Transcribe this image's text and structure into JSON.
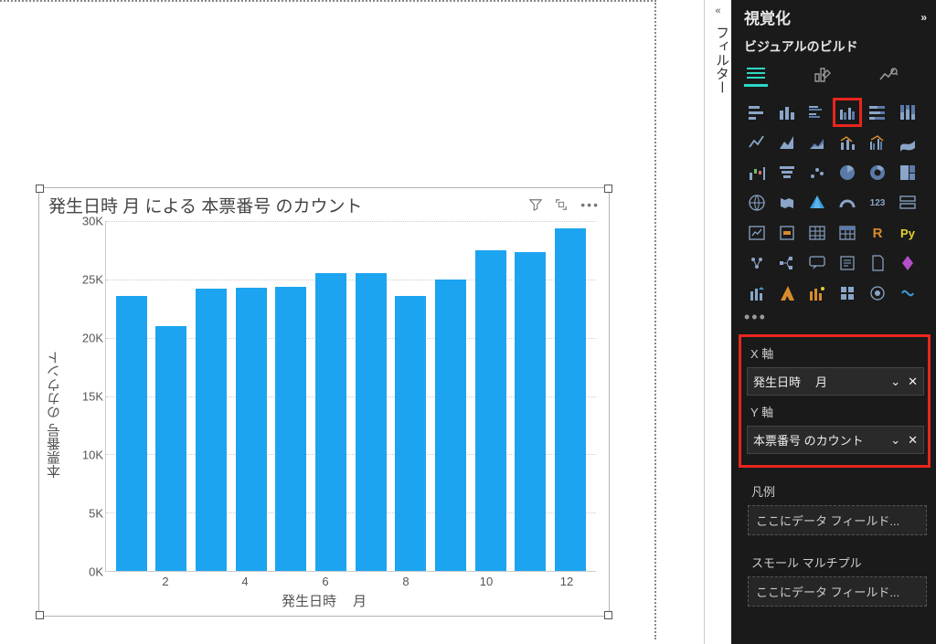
{
  "chart": {
    "title": "発生日時 月 による 本票番号 のカウント",
    "y_axis_label": "本票番号 のカウント",
    "x_axis_label_a": "発生日時",
    "x_axis_label_b": "月",
    "y_ticks": [
      "0K",
      "5K",
      "10K",
      "15K",
      "20K",
      "25K",
      "30K"
    ],
    "x_ticks": [
      "2",
      "4",
      "6",
      "8",
      "10",
      "12"
    ]
  },
  "chart_data": {
    "type": "bar",
    "categories": [
      1,
      2,
      3,
      4,
      5,
      6,
      7,
      8,
      9,
      10,
      11,
      12
    ],
    "values": [
      23600,
      21000,
      24200,
      24300,
      24400,
      25500,
      25500,
      23600,
      25000,
      27500,
      27300,
      29400
    ],
    "title": "発生日時 月 による 本票番号 のカウント",
    "xlabel": "発生日時 月",
    "ylabel": "本票番号 のカウント",
    "ylim": [
      0,
      30000
    ]
  },
  "filters_label": "フィルター",
  "panel": {
    "title": "視覚化",
    "build_label": "ビジュアルのビルド",
    "x_axis_label": "X 軸",
    "x_field_a": "発生日時",
    "x_field_b": "月",
    "y_axis_label": "Y 軸",
    "y_field": "本票番号 のカウント",
    "legend_label": "凡例",
    "legend_placeholder": "ここにデータ フィールド...",
    "small_multiples_label": "スモール マルチプル",
    "small_multiples_placeholder": "ここにデータ フィールド...",
    "r_label": "R",
    "py_label": "Py",
    "num123": "123"
  }
}
